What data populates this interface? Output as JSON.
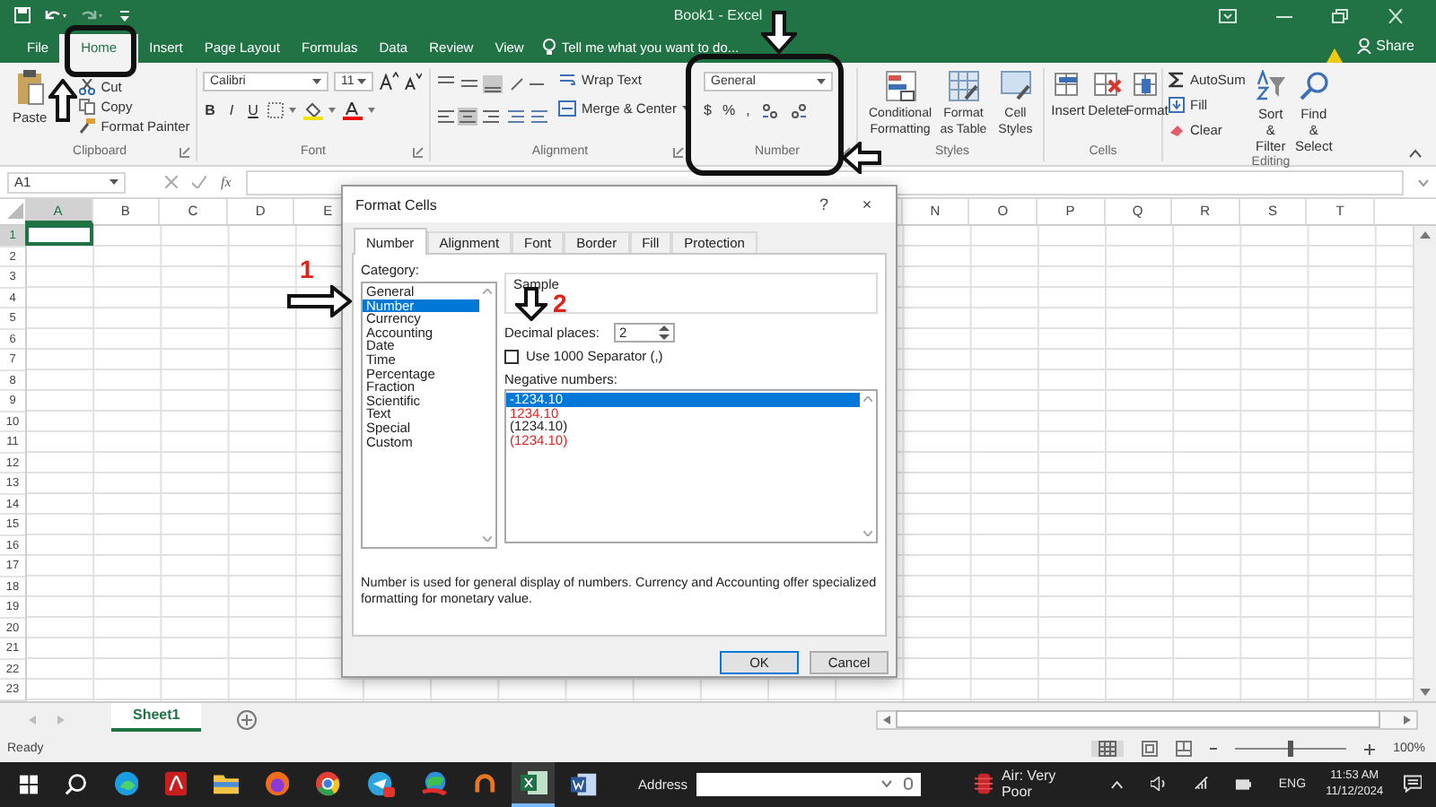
{
  "window": {
    "title": "Book1 - Excel"
  },
  "tabs": [
    {
      "label": "File",
      "selected": false
    },
    {
      "label": "Home",
      "selected": true
    },
    {
      "label": "Insert",
      "selected": false
    },
    {
      "label": "Page Layout",
      "selected": false
    },
    {
      "label": "Formulas",
      "selected": false
    },
    {
      "label": "Data",
      "selected": false
    },
    {
      "label": "Review",
      "selected": false
    },
    {
      "label": "View",
      "selected": false
    }
  ],
  "tell_me": {
    "placeholder": "Tell me what you want to do..."
  },
  "share": "Share",
  "ribbon": {
    "clipboard": {
      "label": "Clipboard",
      "paste": "Paste",
      "cut": "Cut",
      "copy": "Copy",
      "format_painter": "Format Painter"
    },
    "font": {
      "label": "Font",
      "family": "Calibri",
      "size": "11",
      "styles": [
        "B",
        "I",
        "U"
      ]
    },
    "alignment": {
      "label": "Alignment",
      "wrap_text": "Wrap Text",
      "merge": "Merge & Center"
    },
    "number": {
      "label": "Number",
      "format": "General",
      "symbols": [
        "$",
        "%",
        ","
      ]
    },
    "styles": {
      "label": "Styles",
      "buttons": [
        "Conditional Formatting",
        "Format as Table",
        "Cell Styles"
      ]
    },
    "cells": {
      "label": "Cells",
      "buttons": [
        "Insert",
        "Delete",
        "Format"
      ]
    },
    "editing": {
      "label": "Editing",
      "autosum": "AutoSum",
      "fill": "Fill",
      "clear": "Clear",
      "sort": "Sort & Filter",
      "find": "Find & Select"
    }
  },
  "formula_bar": {
    "name_box": "A1",
    "function_label": "fx"
  },
  "sheet": {
    "columns_left": [
      {
        "label": "A",
        "selected": true
      },
      {
        "label": "B",
        "selected": false
      },
      {
        "label": "C",
        "selected": false
      },
      {
        "label": "D",
        "selected": false
      },
      {
        "label": "E",
        "selected": false
      }
    ],
    "columns_right": [
      {
        "label": "N",
        "selected": false
      },
      {
        "label": "O",
        "selected": false
      },
      {
        "label": "P",
        "selected": false
      },
      {
        "label": "Q",
        "selected": false
      },
      {
        "label": "R",
        "selected": false
      },
      {
        "label": "S",
        "selected": false
      },
      {
        "label": "T",
        "selected": false
      }
    ],
    "rows": [
      {
        "label": "1",
        "selected": true
      },
      {
        "label": "2",
        "selected": false
      },
      {
        "label": "3",
        "selected": false
      },
      {
        "label": "4",
        "selected": false
      },
      {
        "label": "5",
        "selected": false
      },
      {
        "label": "6",
        "selected": false
      },
      {
        "label": "7",
        "selected": false
      },
      {
        "label": "8",
        "selected": false
      },
      {
        "label": "9",
        "selected": false
      },
      {
        "label": "10",
        "selected": false
      },
      {
        "label": "11",
        "selected": false
      },
      {
        "label": "12",
        "selected": false
      },
      {
        "label": "13",
        "selected": false
      },
      {
        "label": "14",
        "selected": false
      },
      {
        "label": "15",
        "selected": false
      },
      {
        "label": "16",
        "selected": false
      },
      {
        "label": "17",
        "selected": false
      },
      {
        "label": "18",
        "selected": false
      },
      {
        "label": "19",
        "selected": false
      },
      {
        "label": "20",
        "selected": false
      },
      {
        "label": "21",
        "selected": false
      },
      {
        "label": "22",
        "selected": false
      },
      {
        "label": "23",
        "selected": false
      }
    ]
  },
  "dialog": {
    "title": "Format Cells",
    "help": "?",
    "close": "×",
    "tabs": [
      {
        "label": "Number",
        "selected": true
      },
      {
        "label": "Alignment",
        "selected": false
      },
      {
        "label": "Font",
        "selected": false
      },
      {
        "label": "Border",
        "selected": false
      },
      {
        "label": "Fill",
        "selected": false
      },
      {
        "label": "Protection",
        "selected": false
      }
    ],
    "category_label": "Category:",
    "categories": [
      {
        "label": "General",
        "selected": false
      },
      {
        "label": "Number",
        "selected": true
      },
      {
        "label": "Currency",
        "selected": false
      },
      {
        "label": "Accounting",
        "selected": false
      },
      {
        "label": "Date",
        "selected": false
      },
      {
        "label": "Time",
        "selected": false
      },
      {
        "label": "Percentage",
        "selected": false
      },
      {
        "label": "Fraction",
        "selected": false
      },
      {
        "label": "Scientific",
        "selected": false
      },
      {
        "label": "Text",
        "selected": false
      },
      {
        "label": "Special",
        "selected": false
      },
      {
        "label": "Custom",
        "selected": false
      }
    ],
    "sample_label": "Sample",
    "decimal_label": "Decimal places:",
    "decimal_value": "2",
    "separator": {
      "label": "Use 1000 Separator (,)",
      "checked": false
    },
    "negative_label": "Negative numbers:",
    "negative_formats": [
      {
        "label": "-1234.10",
        "selected": true,
        "red": false
      },
      {
        "label": "1234.10",
        "selected": false,
        "red": true
      },
      {
        "label": "(1234.10)",
        "selected": false,
        "red": false
      },
      {
        "label": "(1234.10)",
        "selected": false,
        "red": true
      }
    ],
    "description": "Number is used for general display of numbers.  Currency and Accounting offer specialized formatting for monetary value.",
    "buttons": [
      "OK",
      "Cancel"
    ]
  },
  "annotations": [
    {
      "label": "1"
    },
    {
      "label": "2"
    }
  ],
  "sheet_tabs": [
    {
      "label": "Sheet1",
      "selected": true
    }
  ],
  "status_bar": {
    "status": "Ready",
    "zoom": "100%",
    "zoom_slider": {
      "level": 0.5
    }
  },
  "taskbar": {
    "address_label": "Address",
    "weather": "Air: Very Poor",
    "language": "ENG",
    "time": "11:53 AM",
    "date": "11/12/2024"
  }
}
